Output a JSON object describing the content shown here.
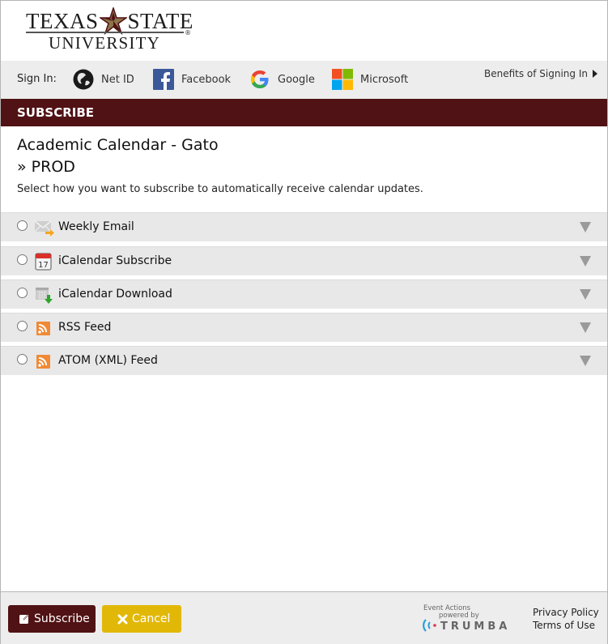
{
  "brand": {
    "line1_left": "TEXAS",
    "line1_right": "STATE",
    "line2": "UNIVERSITY",
    "registered": "®",
    "colors": {
      "maroon": "#501214",
      "gold": "#8d734a"
    }
  },
  "signin": {
    "label": "Sign In:",
    "providers": [
      {
        "name": "Net ID",
        "icon": "globe-icon"
      },
      {
        "name": "Facebook",
        "icon": "facebook-icon"
      },
      {
        "name": "Google",
        "icon": "google-icon"
      },
      {
        "name": "Microsoft",
        "icon": "microsoft-icon"
      }
    ],
    "benefits_link": "Benefits of Signing In"
  },
  "banner": {
    "title": "SUBSCRIBE"
  },
  "calendar": {
    "title": "Academic Calendar - Gato",
    "subtitle": "» PROD",
    "description": "Select how you want to subscribe to automatically receive calendar updates."
  },
  "options": [
    {
      "label": "Weekly Email",
      "icon": "email-forward-icon",
      "selected": false
    },
    {
      "label": "iCalendar Subscribe",
      "icon": "calendar-icon",
      "selected": false
    },
    {
      "label": "iCalendar Download",
      "icon": "calendar-download-icon",
      "selected": false
    },
    {
      "label": "RSS Feed",
      "icon": "rss-icon",
      "selected": false
    },
    {
      "label": "ATOM (XML) Feed",
      "icon": "rss-icon",
      "selected": false
    }
  ],
  "footer": {
    "subscribe_label": "Subscribe",
    "cancel_label": "Cancel",
    "trumba": {
      "line1": "Event Actions",
      "line2": "powered by",
      "word": "TRUMBA"
    },
    "privacy_link": "Privacy Policy",
    "terms_link": "Terms of Use",
    "colors": {
      "subscribe_bg": "#501214",
      "cancel_bg": "#e2b808"
    }
  }
}
